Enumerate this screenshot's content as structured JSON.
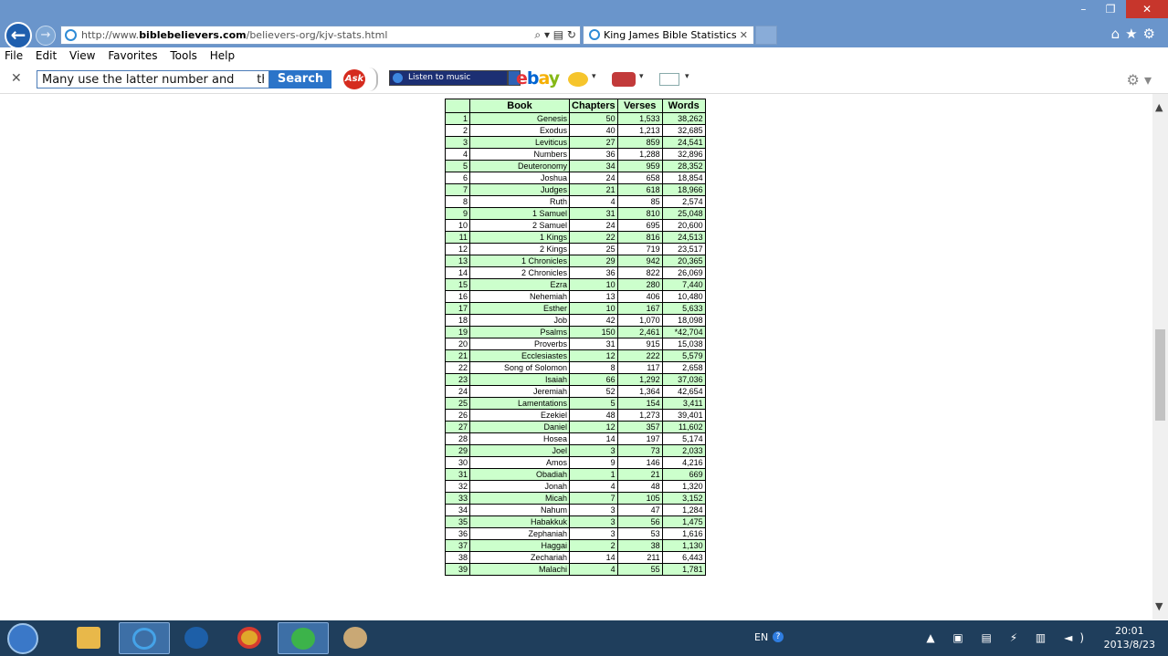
{
  "browser": {
    "url_prefix": "http://www.",
    "url_domain": "biblebelievers.com",
    "url_path": "/believers-org/kjv-stats.html",
    "addr_tools": "⌕ ▾ ▤ ↻",
    "tab_title": "King James Bible Statistics",
    "tab_close": "✕",
    "right_icons": "⌂★⚙"
  },
  "menu": [
    "File",
    "Edit",
    "View",
    "Favorites",
    "Tools",
    "Help"
  ],
  "toolbar": {
    "close": "✕",
    "search_value": "Many use the latter number and      then pr",
    "search_button": "Search",
    "ask_label": "Ask",
    "music_label": "Listen to music",
    "ebay": [
      "e",
      "b",
      "a",
      "y"
    ],
    "dropdown": "▾",
    "gear": "⚙ ▾"
  },
  "table": {
    "headers": [
      "Book",
      "Chapters",
      "Verses",
      "Words"
    ],
    "rows": [
      [
        "1",
        "Genesis",
        "50",
        "1,533",
        "38,262"
      ],
      [
        "2",
        "Exodus",
        "40",
        "1,213",
        "32,685"
      ],
      [
        "3",
        "Leviticus",
        "27",
        "859",
        "24,541"
      ],
      [
        "4",
        "Numbers",
        "36",
        "1,288",
        "32,896"
      ],
      [
        "5",
        "Deuteronomy",
        "34",
        "959",
        "28,352"
      ],
      [
        "6",
        "Joshua",
        "24",
        "658",
        "18,854"
      ],
      [
        "7",
        "Judges",
        "21",
        "618",
        "18,966"
      ],
      [
        "8",
        "Ruth",
        "4",
        "85",
        "2,574"
      ],
      [
        "9",
        "1 Samuel",
        "31",
        "810",
        "25,048"
      ],
      [
        "10",
        "2 Samuel",
        "24",
        "695",
        "20,600"
      ],
      [
        "11",
        "1 Kings",
        "22",
        "816",
        "24,513"
      ],
      [
        "12",
        "2 Kings",
        "25",
        "719",
        "23,517"
      ],
      [
        "13",
        "1 Chronicles",
        "29",
        "942",
        "20,365"
      ],
      [
        "14",
        "2 Chronicles",
        "36",
        "822",
        "26,069"
      ],
      [
        "15",
        "Ezra",
        "10",
        "280",
        "7,440"
      ],
      [
        "16",
        "Nehemiah",
        "13",
        "406",
        "10,480"
      ],
      [
        "17",
        "Esther",
        "10",
        "167",
        "5,633"
      ],
      [
        "18",
        "Job",
        "42",
        "1,070",
        "18,098"
      ],
      [
        "19",
        "Psalms",
        "150",
        "2,461",
        "*42,704"
      ],
      [
        "20",
        "Proverbs",
        "31",
        "915",
        "15,038"
      ],
      [
        "21",
        "Ecclesiastes",
        "12",
        "222",
        "5,579"
      ],
      [
        "22",
        "Song of Solomon",
        "8",
        "117",
        "2,658"
      ],
      [
        "23",
        "Isaiah",
        "66",
        "1,292",
        "37,036"
      ],
      [
        "24",
        "Jeremiah",
        "52",
        "1,364",
        "42,654"
      ],
      [
        "25",
        "Lamentations",
        "5",
        "154",
        "3,411"
      ],
      [
        "26",
        "Ezekiel",
        "48",
        "1,273",
        "39,401"
      ],
      [
        "27",
        "Daniel",
        "12",
        "357",
        "11,602"
      ],
      [
        "28",
        "Hosea",
        "14",
        "197",
        "5,174"
      ],
      [
        "29",
        "Joel",
        "3",
        "73",
        "2,033"
      ],
      [
        "30",
        "Amos",
        "9",
        "146",
        "4,216"
      ],
      [
        "31",
        "Obadiah",
        "1",
        "21",
        "669"
      ],
      [
        "32",
        "Jonah",
        "4",
        "48",
        "1,320"
      ],
      [
        "33",
        "Micah",
        "7",
        "105",
        "3,152"
      ],
      [
        "34",
        "Nahum",
        "3",
        "47",
        "1,284"
      ],
      [
        "35",
        "Habakkuk",
        "3",
        "56",
        "1,475"
      ],
      [
        "36",
        "Zephaniah",
        "3",
        "53",
        "1,616"
      ],
      [
        "37",
        "Haggai",
        "2",
        "38",
        "1,130"
      ],
      [
        "38",
        "Zechariah",
        "14",
        "211",
        "6,443"
      ],
      [
        "39",
        "Malachi",
        "4",
        "55",
        "1,781"
      ]
    ]
  },
  "taskbar": {
    "lang": "EN",
    "help": "?",
    "time": "20:01",
    "date": "2013/8/23",
    "tray": "▲ ▣ ▤ ⚡ ▥ ◄)"
  },
  "window": {
    "minimize": "–",
    "maximize": "❐",
    "close": "✕"
  }
}
